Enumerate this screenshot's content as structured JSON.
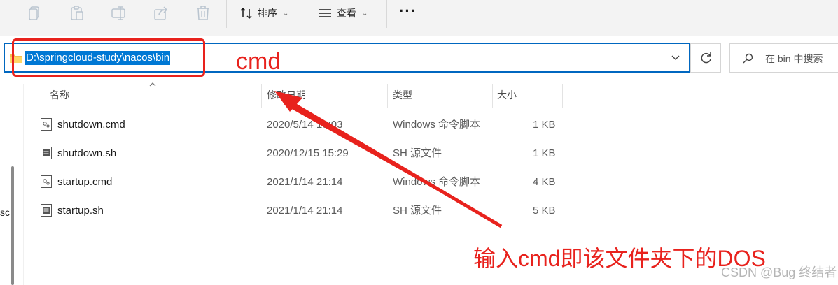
{
  "toolbar": {
    "icons": [
      "copy-icon",
      "paste-icon",
      "rename-icon",
      "share-icon",
      "delete-icon"
    ],
    "sort_label": "排序",
    "view_label": "查看",
    "more_label": "···"
  },
  "address_bar": {
    "path": "D:\\springcloud-study\\nacos\\bin"
  },
  "search": {
    "placeholder": "在 bin 中搜索"
  },
  "left_pane": {
    "cut_text": "sc"
  },
  "columns": {
    "name": "名称",
    "modified": "修改日期",
    "type": "类型",
    "size": "大小"
  },
  "files": [
    {
      "name": "shutdown.cmd",
      "modified": "2020/5/14 10:03",
      "type": "Windows 命令脚本",
      "size": "1 KB",
      "icon": "cmd-file-icon"
    },
    {
      "name": "shutdown.sh",
      "modified": "2020/12/15 15:29",
      "type": "SH 源文件",
      "size": "1 KB",
      "icon": "sh-file-icon"
    },
    {
      "name": "startup.cmd",
      "modified": "2021/1/14 21:14",
      "type": "Windows 命令脚本",
      "size": "4 KB",
      "icon": "cmd-file-icon"
    },
    {
      "name": "startup.sh",
      "modified": "2021/1/14 21:14",
      "type": "SH 源文件",
      "size": "5 KB",
      "icon": "sh-file-icon"
    }
  ],
  "annotations": {
    "cmd_label": "cmd",
    "caption": "输入cmd即该文件夹下的DOS",
    "color": "#e8221d"
  },
  "watermark": "CSDN @Bug 终结者"
}
